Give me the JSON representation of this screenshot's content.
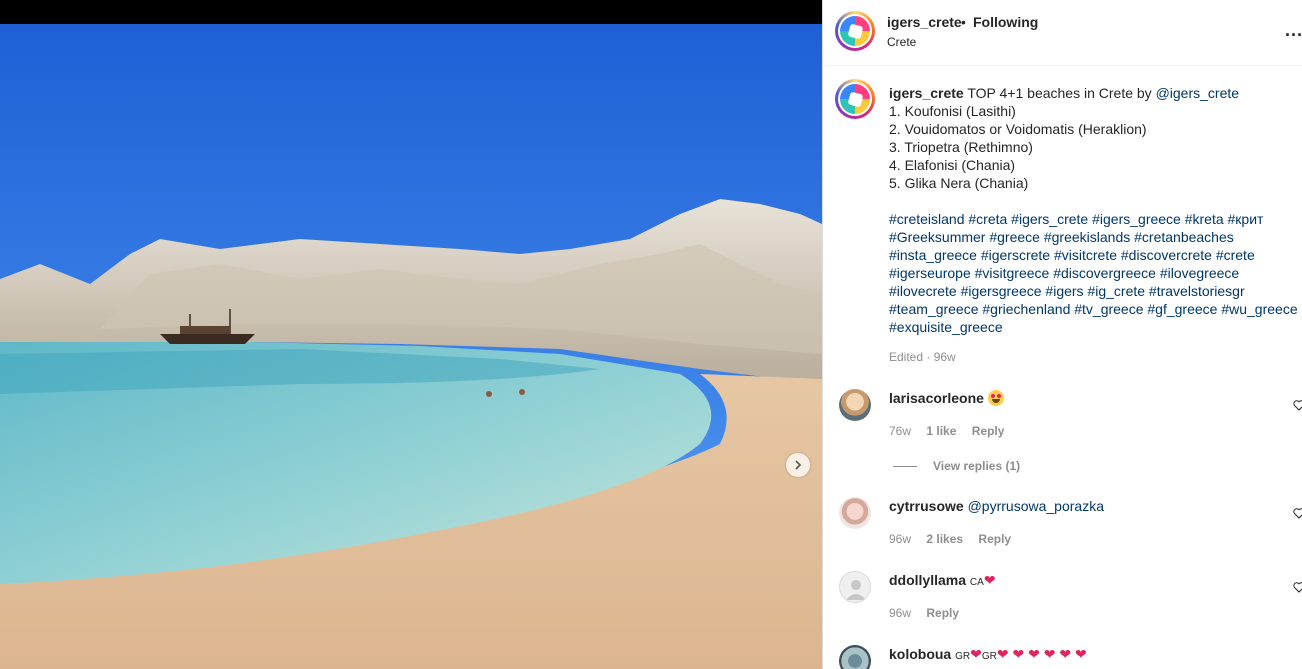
{
  "post": {
    "username": "igers_crete",
    "separator": "•",
    "follow_status": "Following",
    "location": "Crete",
    "more_label": "...",
    "next_icon": "chevron-right-icon"
  },
  "caption": {
    "username": "igers_crete",
    "title": "TOP 4+1 beaches in Crete by ",
    "mention": "@igers_crete",
    "list": [
      "1. Koufonisi (Lasithi)",
      "2. Vouidomatos or Voidomatis (Heraklion)",
      "3. Triopetra (Rethimno)",
      "4. Elafonisi (Chania)",
      "5. Glika Nera (Chania)"
    ],
    "hashtag_lines": [
      "#creteisland #creta #igers_crete #igers_greece #kreta #крит",
      "#Greeksummer #greece #greekislands #cretanbeaches",
      "#insta_greece #igerscrete #visitcrete #discovercrete #crete",
      "#igerseurope #visitgreece #discovergreece #ilovegreece",
      "#ilovecrete #igersgreece #igers #ig_crete #travelstoriesgr",
      "#team_greece #griechenland #tv_greece #gf_greece #wu_greece",
      "#exquisite_greece"
    ],
    "edited": "Edited · 96w"
  },
  "comments": [
    {
      "username": "larisacorleone",
      "text": "",
      "time": "76w",
      "likes": "1 like",
      "reply": "Reply"
    },
    {
      "username": "cytrrusowe",
      "text": "@pyrrusowa_porazka",
      "time": "96w",
      "likes": "2 likes",
      "reply": "Reply"
    },
    {
      "username": "ddollyllama",
      "text": "CA",
      "time": "96w",
      "likes": "",
      "reply": "Reply"
    },
    {
      "username": "koloboua",
      "text": "GR",
      "text2": "GR",
      "time": "",
      "likes": "",
      "reply": ""
    }
  ],
  "view_replies": "View replies (1)",
  "colors": {
    "link": "#00376b",
    "muted": "#8e8e8e",
    "heart": "#e0245e"
  }
}
